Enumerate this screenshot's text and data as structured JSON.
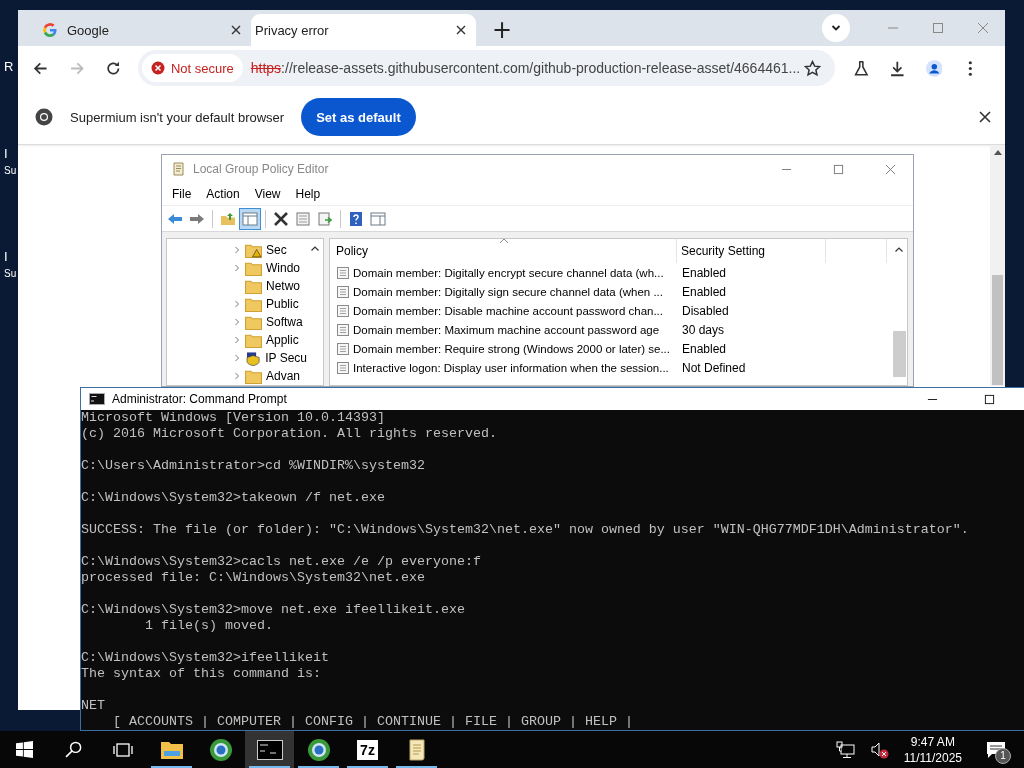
{
  "desktop": {
    "labels": [
      {
        "lines": [
          "R"
        ]
      },
      {
        "lines": [
          "I",
          "Su"
        ]
      },
      {
        "lines": [
          "I",
          "Su"
        ]
      }
    ]
  },
  "browser": {
    "tabs": [
      {
        "title": "Google",
        "kind": "site",
        "selected": false
      },
      {
        "title": "Privacy error",
        "kind": "error",
        "selected": true
      }
    ],
    "new_tab": "+",
    "security_chip": "Not secure",
    "url_scheme": "https",
    "url_rest": "://release-assets.githubusercontent.com/github-production-release-asset/4664461...",
    "infobar": {
      "message": "Supermium isn't your default browser",
      "button": "Set as default"
    }
  },
  "policy_editor": {
    "title": "Local Group Policy Editor",
    "menu": [
      "File",
      "Action",
      "View",
      "Help"
    ],
    "toolbar": [
      {
        "kind": "back",
        "pressed": false
      },
      {
        "kind": "forward",
        "pressed": false
      },
      {
        "kind": "sep"
      },
      {
        "kind": "up",
        "pressed": false
      },
      {
        "kind": "tree",
        "pressed": true
      },
      {
        "kind": "sep"
      },
      {
        "kind": "delete",
        "pressed": false
      },
      {
        "kind": "properties",
        "pressed": false
      },
      {
        "kind": "export",
        "pressed": false
      },
      {
        "kind": "sep"
      },
      {
        "kind": "help",
        "pressed": false
      },
      {
        "kind": "view",
        "pressed": false
      }
    ],
    "tree": [
      {
        "label": "Sec",
        "kind": "security",
        "expandable": true
      },
      {
        "label": "Windo",
        "kind": "folder",
        "expandable": true
      },
      {
        "label": "Netwo",
        "kind": "folder",
        "expandable": false
      },
      {
        "label": "Public",
        "kind": "folder",
        "expandable": true
      },
      {
        "label": "Softwa",
        "kind": "folder",
        "expandable": true
      },
      {
        "label": "Applic",
        "kind": "folder",
        "expandable": true
      },
      {
        "label": "IP Secu",
        "kind": "ipsec",
        "expandable": true
      },
      {
        "label": "Advan",
        "kind": "folder",
        "expandable": true
      }
    ],
    "columns": [
      {
        "label": "Policy",
        "sorted": true
      },
      {
        "label": "Security Setting",
        "sorted": false
      }
    ],
    "rows": [
      {
        "policy": "Domain member: Digitally encrypt secure channel data (wh...",
        "setting": "Enabled"
      },
      {
        "policy": "Domain member: Digitally sign secure channel data (when ...",
        "setting": "Enabled"
      },
      {
        "policy": "Domain member: Disable machine account password chan...",
        "setting": "Disabled"
      },
      {
        "policy": "Domain member: Maximum machine account password age",
        "setting": "30 days"
      },
      {
        "policy": "Domain member: Require strong (Windows 2000 or later) se...",
        "setting": "Enabled"
      },
      {
        "policy": "Interactive logon: Display user information when the session...",
        "setting": "Not Defined"
      }
    ]
  },
  "command_prompt": {
    "title": "Administrator: Command Prompt",
    "blocks": [
      [
        "Microsoft Windows [Version 10.0.14393]",
        "(c) 2016 Microsoft Corporation. All rights reserved."
      ],
      [
        "C:\\Users\\Administrator>cd %WINDIR%\\system32"
      ],
      [
        "C:\\Windows\\System32>takeown /f net.exe"
      ],
      [
        "SUCCESS: The file (or folder): \"C:\\Windows\\System32\\net.exe\" now owned by user \"WIN-QHG77MDF1DH\\Administrator\"."
      ],
      [
        "C:\\Windows\\System32>cacls net.exe /e /p everyone:f",
        "processed file: C:\\Windows\\System32\\net.exe"
      ],
      [
        "C:\\Windows\\System32>move net.exe ifeellikeit.exe",
        "        1 file(s) moved."
      ],
      [
        "C:\\Windows\\System32>ifeellikeit",
        "The syntax of this command is:"
      ],
      [
        "NET",
        "    [ ACCOUNTS | COMPUTER | CONFIG | CONTINUE | FILE | GROUP | HELP |"
      ]
    ]
  },
  "taskbar": {
    "apps": [
      {
        "kind": "explorer",
        "running": true,
        "active": false
      },
      {
        "kind": "browser",
        "running": false,
        "active": false
      },
      {
        "kind": "terminal",
        "running": true,
        "active": true
      },
      {
        "kind": "browser",
        "running": true,
        "active": false
      },
      {
        "kind": "archiver",
        "label": "7z",
        "running": true,
        "active": false
      },
      {
        "kind": "notepad",
        "running": true,
        "active": false
      }
    ],
    "time": "9:47 AM",
    "date": "11/11/2025",
    "notification_count": "1"
  }
}
